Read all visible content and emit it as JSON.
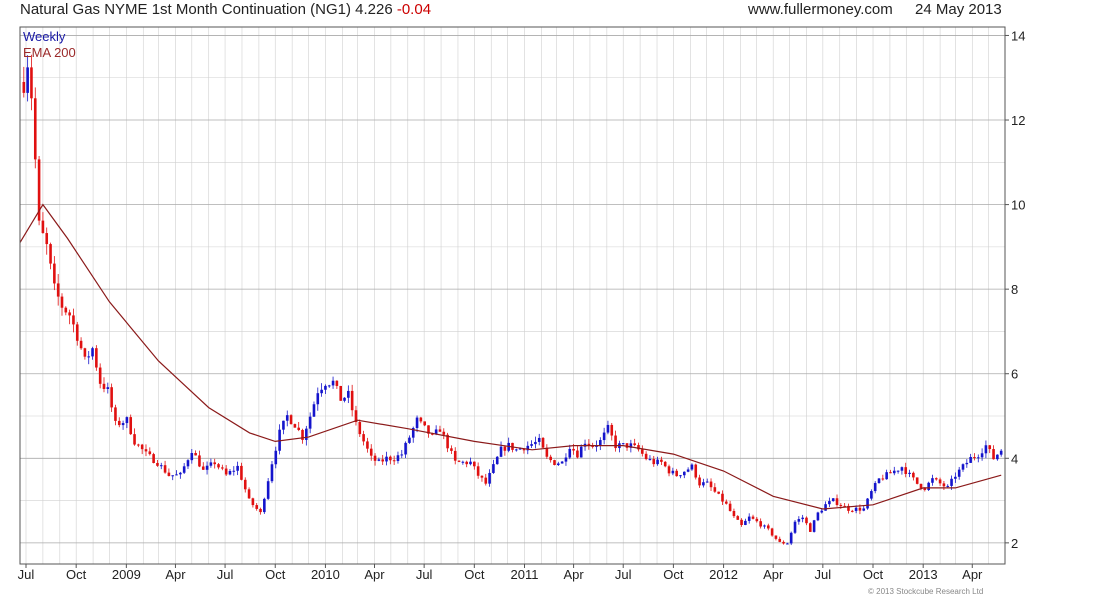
{
  "header": {
    "title": "Natural Gas NYME 1st Month Continuation (NG1) 4.226",
    "change": "-0.04",
    "site": "www.fullermoney.com",
    "date": "24 May 2013"
  },
  "footer": {
    "copyright": "© 2013 Stockcube Research Ltd"
  },
  "colors": {
    "up": "#1414cc",
    "down": "#e01010",
    "ema": "#8b1a1a",
    "grid": "#d0d0d0"
  },
  "chart_data": {
    "type": "candlestick",
    "legend": [
      "Weekly",
      "EMA 200"
    ],
    "ylim": [
      1.5,
      14.2
    ],
    "y_ticks": [
      2,
      4,
      6,
      8,
      10,
      12,
      14
    ],
    "y_tick_labels": [
      "2",
      "4",
      "6",
      "8",
      "10",
      "12",
      "14"
    ],
    "x_range": [
      "2008-06-20",
      "2013-05-31"
    ],
    "x_ticks": [
      {
        "label": "Jul",
        "date": "2008-07-01"
      },
      {
        "label": "Oct",
        "date": "2008-10-01"
      },
      {
        "label": "2009",
        "date": "2009-01-01"
      },
      {
        "label": "Apr",
        "date": "2009-04-01"
      },
      {
        "label": "Jul",
        "date": "2009-07-01"
      },
      {
        "label": "Oct",
        "date": "2009-10-01"
      },
      {
        "label": "2010",
        "date": "2010-01-01"
      },
      {
        "label": "Apr",
        "date": "2010-04-01"
      },
      {
        "label": "Jul",
        "date": "2010-07-01"
      },
      {
        "label": "Oct",
        "date": "2010-10-01"
      },
      {
        "label": "2011",
        "date": "2011-01-01"
      },
      {
        "label": "Apr",
        "date": "2011-04-01"
      },
      {
        "label": "Jul",
        "date": "2011-07-01"
      },
      {
        "label": "Oct",
        "date": "2011-10-01"
      },
      {
        "label": "2012",
        "date": "2012-01-01"
      },
      {
        "label": "Apr",
        "date": "2012-04-01"
      },
      {
        "label": "Jul",
        "date": "2012-07-01"
      },
      {
        "label": "Oct",
        "date": "2012-10-01"
      },
      {
        "label": "2013",
        "date": "2013-01-01"
      },
      {
        "label": "Apr",
        "date": "2013-04-01"
      }
    ],
    "close_path": [
      [
        "2008-06-27",
        12.9
      ],
      [
        "2008-07-04",
        13.4
      ],
      [
        "2008-07-11",
        12.6
      ],
      [
        "2008-07-25",
        9.5
      ],
      [
        "2008-08-08",
        9.0
      ],
      [
        "2008-08-22",
        8.0
      ],
      [
        "2008-09-05",
        7.6
      ],
      [
        "2008-09-19",
        7.4
      ],
      [
        "2008-10-03",
        6.9
      ],
      [
        "2008-10-17",
        6.3
      ],
      [
        "2008-10-31",
        6.6
      ],
      [
        "2008-11-14",
        5.8
      ],
      [
        "2008-11-28",
        5.6
      ],
      [
        "2008-12-12",
        4.8
      ],
      [
        "2009-01-02",
        4.9
      ],
      [
        "2009-01-16",
        4.4
      ],
      [
        "2009-02-06",
        4.1
      ],
      [
        "2009-02-27",
        3.9
      ],
      [
        "2009-03-20",
        3.6
      ],
      [
        "2009-04-10",
        3.6
      ],
      [
        "2009-05-01",
        4.2
      ],
      [
        "2009-05-22",
        3.7
      ],
      [
        "2009-06-12",
        3.9
      ],
      [
        "2009-07-03",
        3.6
      ],
      [
        "2009-07-24",
        3.8
      ],
      [
        "2009-08-14",
        3.0
      ],
      [
        "2009-09-04",
        2.7
      ],
      [
        "2009-09-25",
        3.9
      ],
      [
        "2009-10-09",
        4.6
      ],
      [
        "2009-10-23",
        5.0
      ],
      [
        "2009-11-06",
        4.8
      ],
      [
        "2009-11-20",
        4.5
      ],
      [
        "2009-12-04",
        5.0
      ],
      [
        "2009-12-18",
        5.6
      ],
      [
        "2010-01-01",
        5.8
      ],
      [
        "2010-01-15",
        5.8
      ],
      [
        "2010-01-29",
        5.4
      ],
      [
        "2010-02-12",
        5.5
      ],
      [
        "2010-02-26",
        4.8
      ],
      [
        "2010-03-12",
        4.4
      ],
      [
        "2010-03-26",
        4.0
      ],
      [
        "2010-04-09",
        3.9
      ],
      [
        "2010-04-23",
        4.0
      ],
      [
        "2010-05-07",
        4.0
      ],
      [
        "2010-05-21",
        4.1
      ],
      [
        "2010-06-04",
        4.5
      ],
      [
        "2010-06-18",
        4.9
      ],
      [
        "2010-07-02",
        4.7
      ],
      [
        "2010-07-16",
        4.5
      ],
      [
        "2010-07-30",
        4.7
      ],
      [
        "2010-08-13",
        4.3
      ],
      [
        "2010-08-27",
        3.9
      ],
      [
        "2010-09-10",
        3.9
      ],
      [
        "2010-09-24",
        3.9
      ],
      [
        "2010-10-08",
        3.6
      ],
      [
        "2010-10-22",
        3.4
      ],
      [
        "2010-11-05",
        3.8
      ],
      [
        "2010-11-19",
        4.2
      ],
      [
        "2010-12-03",
        4.3
      ],
      [
        "2010-12-17",
        4.2
      ],
      [
        "2011-01-07",
        4.3
      ],
      [
        "2011-01-28",
        4.4
      ],
      [
        "2011-02-11",
        4.0
      ],
      [
        "2011-02-25",
        3.9
      ],
      [
        "2011-03-11",
        3.9
      ],
      [
        "2011-03-25",
        4.3
      ],
      [
        "2011-04-08",
        4.1
      ],
      [
        "2011-04-22",
        4.4
      ],
      [
        "2011-05-06",
        4.3
      ],
      [
        "2011-05-20",
        4.4
      ],
      [
        "2011-06-03",
        4.7
      ],
      [
        "2011-06-17",
        4.3
      ],
      [
        "2011-07-01",
        4.3
      ],
      [
        "2011-07-15",
        4.3
      ],
      [
        "2011-07-29",
        4.2
      ],
      [
        "2011-08-12",
        4.0
      ],
      [
        "2011-08-26",
        3.9
      ],
      [
        "2011-09-09",
        3.9
      ],
      [
        "2011-09-23",
        3.7
      ],
      [
        "2011-10-07",
        3.6
      ],
      [
        "2011-10-21",
        3.7
      ],
      [
        "2011-11-04",
        3.8
      ],
      [
        "2011-11-18",
        3.4
      ],
      [
        "2011-12-02",
        3.4
      ],
      [
        "2011-12-16",
        3.2
      ],
      [
        "2012-01-06",
        2.9
      ],
      [
        "2012-01-20",
        2.6
      ],
      [
        "2012-02-03",
        2.4
      ],
      [
        "2012-02-17",
        2.6
      ],
      [
        "2012-03-02",
        2.5
      ],
      [
        "2012-03-23",
        2.3
      ],
      [
        "2012-04-13",
        2.0
      ],
      [
        "2012-04-27",
        2.0
      ],
      [
        "2012-05-11",
        2.5
      ],
      [
        "2012-05-25",
        2.6
      ],
      [
        "2012-06-08",
        2.3
      ],
      [
        "2012-06-22",
        2.7
      ],
      [
        "2012-07-06",
        2.9
      ],
      [
        "2012-07-20",
        3.0
      ],
      [
        "2012-08-03",
        2.9
      ],
      [
        "2012-08-17",
        2.8
      ],
      [
        "2012-08-31",
        2.8
      ],
      [
        "2012-09-14",
        2.8
      ],
      [
        "2012-09-28",
        3.2
      ],
      [
        "2012-10-12",
        3.5
      ],
      [
        "2012-10-26",
        3.6
      ],
      [
        "2012-11-09",
        3.7
      ],
      [
        "2012-11-23",
        3.8
      ],
      [
        "2012-12-07",
        3.6
      ],
      [
        "2012-12-21",
        3.4
      ],
      [
        "2013-01-04",
        3.3
      ],
      [
        "2013-01-18",
        3.5
      ],
      [
        "2013-02-01",
        3.4
      ],
      [
        "2013-02-15",
        3.3
      ],
      [
        "2013-03-01",
        3.6
      ],
      [
        "2013-03-15",
        3.8
      ],
      [
        "2013-03-29",
        4.0
      ],
      [
        "2013-04-12",
        4.1
      ],
      [
        "2013-04-26",
        4.3
      ],
      [
        "2013-05-10",
        4.0
      ],
      [
        "2013-05-24",
        4.2
      ]
    ],
    "ema_path": [
      [
        "2008-06-20",
        9.1
      ],
      [
        "2008-08-01",
        10.0
      ],
      [
        "2008-09-15",
        9.2
      ],
      [
        "2008-12-01",
        7.7
      ],
      [
        "2009-03-01",
        6.3
      ],
      [
        "2009-06-01",
        5.2
      ],
      [
        "2009-08-15",
        4.6
      ],
      [
        "2009-10-01",
        4.4
      ],
      [
        "2009-12-01",
        4.5
      ],
      [
        "2010-03-01",
        4.9
      ],
      [
        "2010-06-01",
        4.7
      ],
      [
        "2010-10-01",
        4.4
      ],
      [
        "2011-01-15",
        4.2
      ],
      [
        "2011-04-01",
        4.3
      ],
      [
        "2011-07-01",
        4.3
      ],
      [
        "2011-10-01",
        4.1
      ],
      [
        "2012-01-01",
        3.7
      ],
      [
        "2012-04-01",
        3.1
      ],
      [
        "2012-07-01",
        2.8
      ],
      [
        "2012-10-01",
        2.9
      ],
      [
        "2013-01-01",
        3.3
      ],
      [
        "2013-03-01",
        3.3
      ],
      [
        "2013-05-24",
        3.6
      ]
    ]
  }
}
